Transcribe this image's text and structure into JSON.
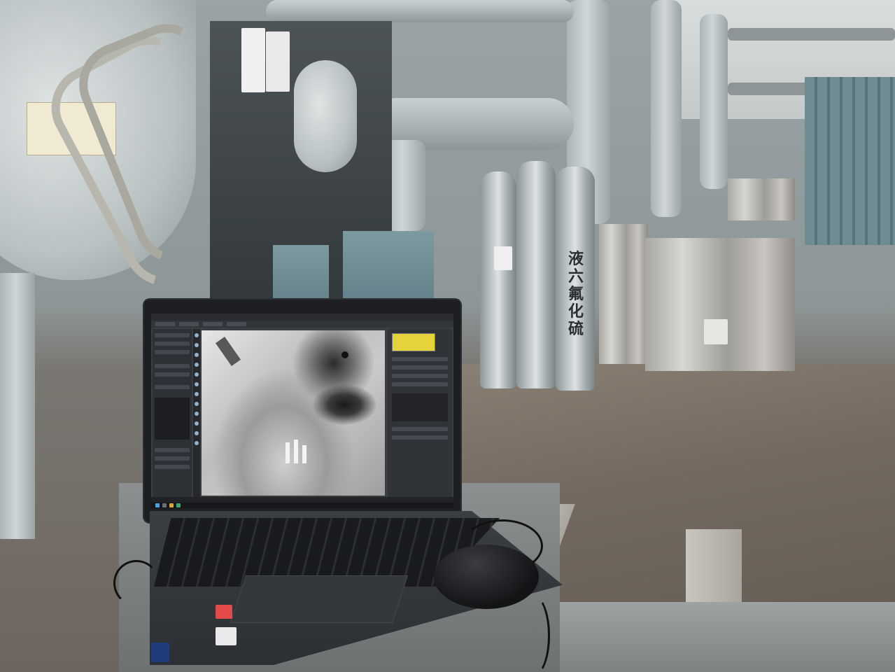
{
  "scene": {
    "gas_cylinder_label_chars": [
      "液",
      "六",
      "氟",
      "化",
      "硫"
    ],
    "colors": {
      "equipment_gray": "#c9d0d1",
      "stainless": "#d8d6d1",
      "floor": "#73695f",
      "laptop": "#2c2f33",
      "histogram_yellow": "#e6d23a"
    }
  },
  "laptop_screen": {
    "app": "radiographic-image-viewer",
    "panels": [
      "left-parameter-panel",
      "tool-strip",
      "x-ray-image",
      "right-histogram-panel",
      "status-bar",
      "taskbar"
    ]
  }
}
